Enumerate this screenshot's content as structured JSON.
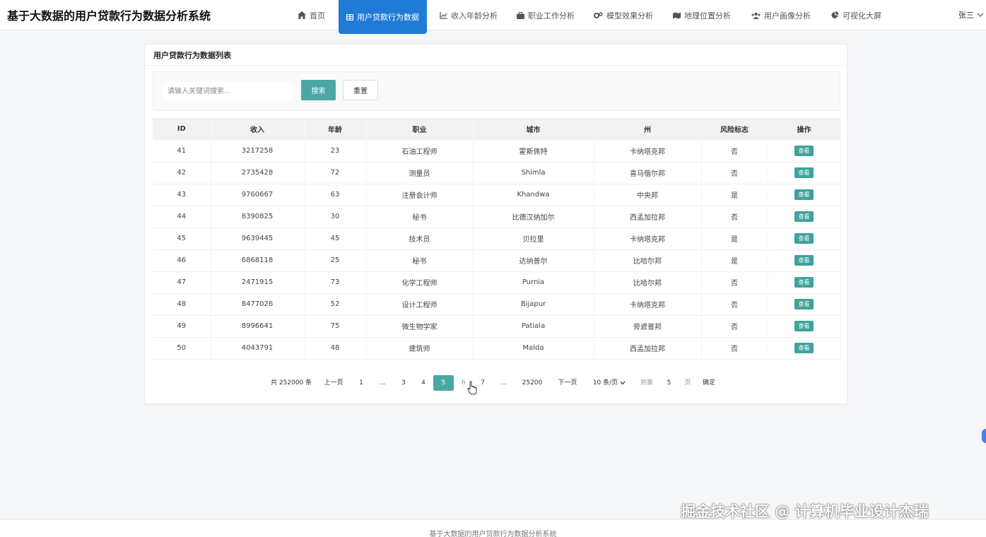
{
  "app": {
    "title": "基于大数据的用户贷款行为数据分析系统"
  },
  "nav": {
    "items": [
      {
        "label": "首页",
        "icon": "home-icon"
      },
      {
        "label": "用户贷款行为数据",
        "icon": "table-icon",
        "active": true
      },
      {
        "label": "收入年龄分析",
        "icon": "line-chart-icon"
      },
      {
        "label": "职业工作分析",
        "icon": "briefcase-icon"
      },
      {
        "label": "模型效果分析",
        "icon": "gears-icon"
      },
      {
        "label": "地理位置分析",
        "icon": "map-icon"
      },
      {
        "label": "用户画像分析",
        "icon": "users-icon"
      },
      {
        "label": "可视化大屏",
        "icon": "pie-chart-icon"
      }
    ],
    "user": "张三"
  },
  "card": {
    "title": "用户贷款行为数据列表"
  },
  "search": {
    "placeholder": "请输入关键词搜索...",
    "search_label": "搜索",
    "reset_label": "重置"
  },
  "table": {
    "headers": [
      "ID",
      "收入",
      "年龄",
      "职业",
      "城市",
      "州",
      "风险标志",
      "操作"
    ],
    "view_label": "查看",
    "rows": [
      [
        "41",
        "3217258",
        "23",
        "石油工程师",
        "霍斯佩特",
        "卡纳塔克邦",
        "否"
      ],
      [
        "42",
        "2735428",
        "72",
        "测量员",
        "Shimla",
        "喜马偕尔邦",
        "否"
      ],
      [
        "43",
        "9760667",
        "63",
        "注册会计师",
        "Khandwa",
        "中央邦",
        "是"
      ],
      [
        "44",
        "8390825",
        "30",
        "秘书",
        "比德汉纳加尔",
        "西孟加拉邦",
        "否"
      ],
      [
        "45",
        "9639445",
        "45",
        "技术员",
        "贝拉里",
        "卡纳塔克邦",
        "是"
      ],
      [
        "46",
        "6868118",
        "25",
        "秘书",
        "达纳普尔",
        "比哈尔邦",
        "是"
      ],
      [
        "47",
        "2471915",
        "73",
        "化学工程师",
        "Purnia",
        "比哈尔邦",
        "否"
      ],
      [
        "48",
        "8477026",
        "52",
        "设计工程师",
        "Bijapur",
        "卡纳塔克邦",
        "否"
      ],
      [
        "49",
        "8996641",
        "75",
        "微生物学家",
        "Patiala",
        "旁遮普邦",
        "否"
      ],
      [
        "50",
        "4043791",
        "48",
        "建筑师",
        "Malda",
        "西孟加拉邦",
        "否"
      ]
    ]
  },
  "pagination": {
    "total": "共 252000 条",
    "prev": "上一页",
    "pages": [
      "1",
      "...",
      "3",
      "4",
      "5",
      "6",
      "7",
      "...",
      "25200"
    ],
    "current_page": "5",
    "next": "下一页",
    "page_size": "10 条/页",
    "goto_prefix": "到第",
    "goto_value": "5",
    "goto_suffix": "页",
    "confirm": "确定"
  },
  "footer": {
    "text": "基于大数据的用户贷款行为数据分析系统"
  },
  "watermark": {
    "text": "掘金技术社区 @ 计算机毕业设计杰瑞"
  },
  "colors": {
    "nav_active": "#1f7bd6",
    "primary": "#4aa7a5",
    "view_button": "#3fa39b"
  }
}
